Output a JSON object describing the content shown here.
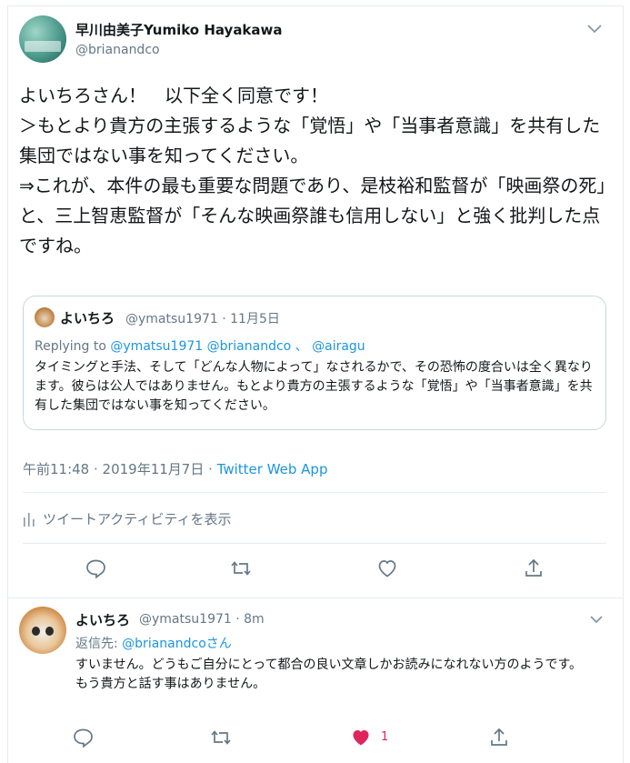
{
  "tweet": {
    "display_name": "早川由美子Yumiko Hayakawa",
    "handle": "@brianandco",
    "text": "よいちろさん！　以下全く同意です！\n＞もとより貴方の主張するような「覚悟」や「当事者意識」を共有した集団ではない事を知ってください。\n⇒これが、本件の最も重要な問題であり、是枝裕和監督が「映画祭の死」と、三上智恵監督が「そんな映画祭誰も信用しない」と強く批判した点ですね。",
    "timestamp": "午前11:48 · 2019年11月7日",
    "source": "Twitter Web App",
    "activity_label": "ツイートアクティビティを表示"
  },
  "quoted": {
    "name": "よいちろ",
    "handle_date": "@ymatsu1971 · 11月5日",
    "replying_prefix": "Replying to ",
    "replying_users": "@ymatsu1971 @brianandco 、 @airagu",
    "text": "タイミングと手法、そして「どんな人物によって」なされるかで、その恐怖の度合いは全く異なります。彼らは公人ではありません。もとより貴方の主張するような「覚悟」や「当事者意識」を共有した集団ではない事を知ってください。"
  },
  "reply": {
    "name": "よいちろ",
    "handle_time": "@ymatsu1971 · 8m",
    "reply_prefix": "返信先: ",
    "reply_target": "@brianandcoさん",
    "text": "すいません。どうもご自分にとって都合の良い文章しかお読みになれない方のようです。\nもう貴方と話す事はありません。",
    "like_count": "1"
  },
  "colors": {
    "link": "#1b95e0",
    "muted": "#657786",
    "like": "#e0245e"
  }
}
